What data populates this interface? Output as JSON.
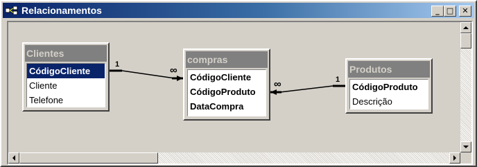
{
  "window": {
    "title": "Relacionamentos",
    "minimize_label": "_",
    "restore_label": "□",
    "close_label": "✕"
  },
  "tables": {
    "clientes": {
      "title": "Clientes",
      "fields": [
        "CódigoCliente",
        "Cliente",
        "Telefone"
      ]
    },
    "compras": {
      "title": "compras",
      "fields": [
        "CódigoCliente",
        "CódigoProduto",
        "DataCompra"
      ]
    },
    "produtos": {
      "title": "Produtos",
      "fields": [
        "CódigoProduto",
        "Descrição"
      ]
    }
  },
  "relationships": [
    {
      "from": "Clientes.CódigoCliente",
      "to": "compras.CódigoCliente",
      "one_label": "1",
      "many_label": "∞"
    },
    {
      "from": "Produtos.CódigoProduto",
      "to": "compras.CódigoProduto",
      "one_label": "1",
      "many_label": "∞"
    }
  ],
  "colors": {
    "title_gradient_start": "#0a246a",
    "title_gradient_end": "#a6caf0",
    "selection": "#0a246a"
  }
}
